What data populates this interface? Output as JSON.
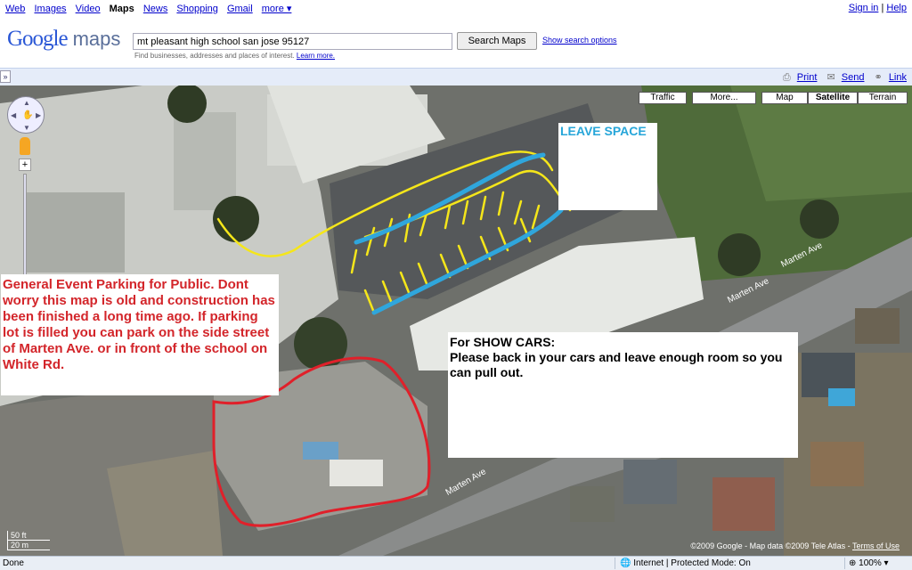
{
  "topnav": {
    "links": [
      {
        "label": "Web",
        "active": false
      },
      {
        "label": "Images",
        "active": false
      },
      {
        "label": "Video",
        "active": false
      },
      {
        "label": "Maps",
        "active": true
      },
      {
        "label": "News",
        "active": false
      },
      {
        "label": "Shopping",
        "active": false
      },
      {
        "label": "Gmail",
        "active": false
      },
      {
        "label": "more ▾",
        "active": false
      }
    ],
    "sign_in": "Sign in",
    "separator": "|",
    "help": "Help"
  },
  "header": {
    "logo_text": "Google",
    "logo_suffix": "maps",
    "search_value": "mt pleasant high school san jose 95127",
    "search_button": "Search Maps",
    "search_options": "Show search options",
    "hint": "Find businesses, addresses and places of interest.",
    "hint_link": "Learn more."
  },
  "toolbar": {
    "expand_icon": "»",
    "print": "Print",
    "send": "Send",
    "link": "Link"
  },
  "map": {
    "buttons": {
      "traffic": "Traffic",
      "more": "More...",
      "map": "Map",
      "satellite": "Satellite",
      "terrain": "Terrain"
    },
    "selected_type": "Satellite",
    "zoom_in": "+",
    "zoom_out": "−",
    "scale_ft": "50 ft",
    "scale_m": "20 m",
    "street_label_1": "Marten Ave",
    "street_label_2": "Marten Ave",
    "street_label_3": "Marten Ave",
    "copyright": "©2009 Google - Map data ©2009 Tele Atlas -",
    "terms": "Terms of Use"
  },
  "notes": {
    "general": "General Event Parking for Public. Dont worry this map is old and construction has been finished a long time ago. If parking lot is filled you can park on the side street of Marten Ave. or in front of the school on White Rd.",
    "show_title": "For SHOW CARS:",
    "show_body": "Please back in your cars and leave enough room so you can pull out.",
    "leave_space": "LEAVE SPACE"
  },
  "colors": {
    "yellow_marks": "#f5e61a",
    "blue_marks": "#2fa6dc",
    "red_outline": "#e0202a",
    "general_note_text": "#d3252a",
    "leave_space_text": "#27a6d9"
  },
  "statusbar": {
    "done": "Done",
    "zone": "Internet | Protected Mode: On",
    "zoom": "100%"
  }
}
